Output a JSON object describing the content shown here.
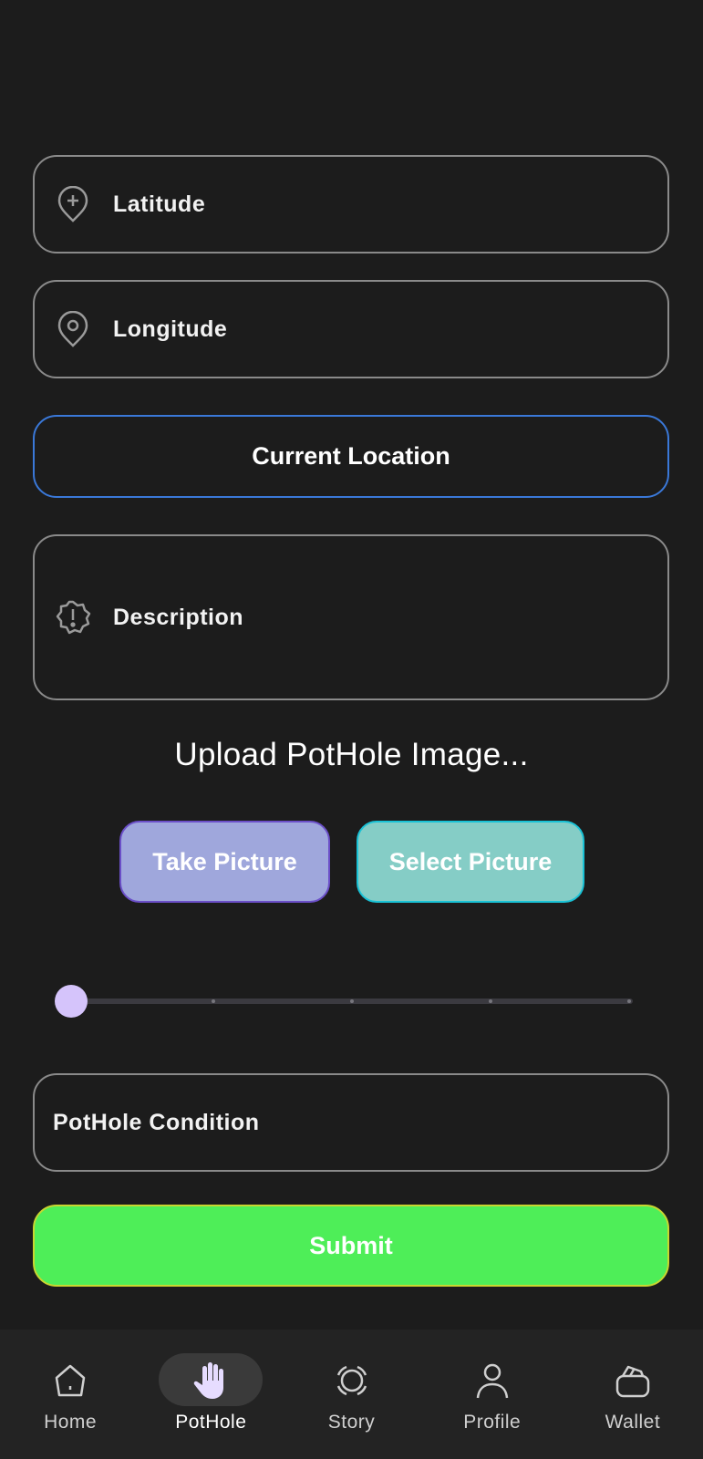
{
  "form": {
    "latitude_label": "Latitude",
    "longitude_label": "Longitude",
    "current_location_label": "Current Location",
    "description_label": "Description",
    "upload_title": "Upload PotHole Image...",
    "take_picture_label": "Take Picture",
    "select_picture_label": "Select Picture",
    "slider": {
      "value": 0,
      "min": 0,
      "max": 4,
      "step": 1
    },
    "condition_label": "PotHole Condition",
    "submit_label": "Submit"
  },
  "nav": {
    "items": [
      {
        "label": "Home",
        "icon": "home-icon",
        "active": false
      },
      {
        "label": "PotHole",
        "icon": "hand-icon",
        "active": true
      },
      {
        "label": "Story",
        "icon": "story-icon",
        "active": false
      },
      {
        "label": "Profile",
        "icon": "person-icon",
        "active": false
      },
      {
        "label": "Wallet",
        "icon": "wallet-icon",
        "active": false
      }
    ]
  },
  "colors": {
    "background": "#1c1c1c",
    "field_border": "#8a8a8a",
    "location_border": "#3a78d8",
    "take_picture_bg": "#9fa7dc",
    "select_picture_bg": "#85cdc6",
    "submit_bg": "#4eee58",
    "slider_thumb": "#d5c4fb",
    "navbar_bg": "#232323"
  }
}
